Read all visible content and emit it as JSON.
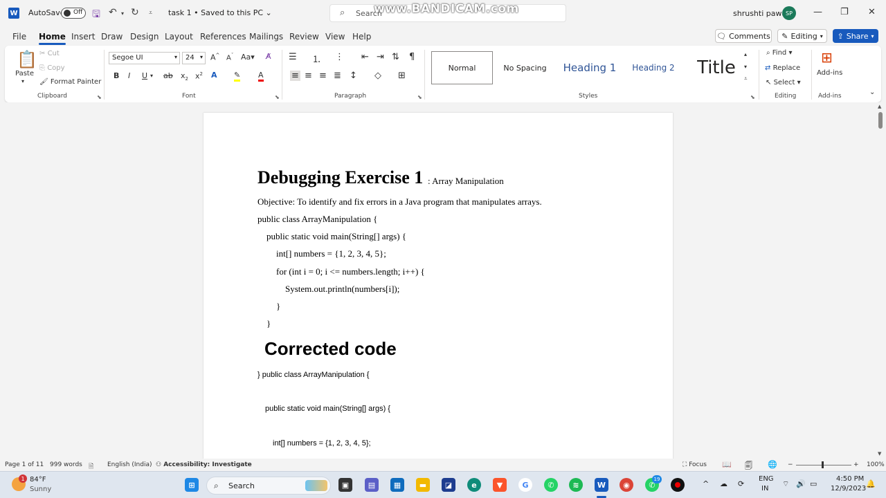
{
  "titlebar": {
    "autosave_label": "AutoSave",
    "autosave_state": "Off",
    "doc_title": "task 1 • Saved to this PC",
    "search_placeholder": "Search",
    "watermark": "www.BANDICAM.com",
    "user_name": "shrushti pawar",
    "user_initials": "SP"
  },
  "menu": {
    "tabs": [
      "File",
      "Home",
      "Insert",
      "Draw",
      "Design",
      "Layout",
      "References",
      "Mailings",
      "Review",
      "View",
      "Help"
    ],
    "comments": "Comments",
    "editing": "Editing",
    "share": "Share"
  },
  "ribbon": {
    "clipboard": {
      "paste": "Paste",
      "cut": "Cut",
      "copy": "Copy",
      "format_painter": "Format Painter",
      "label": "Clipboard"
    },
    "font": {
      "name": "Segoe UI",
      "size": "24",
      "label": "Font"
    },
    "paragraph": {
      "label": "Paragraph"
    },
    "styles": {
      "items": [
        "Normal",
        "No Spacing",
        "Heading 1",
        "Heading 2",
        "Title"
      ],
      "label": "Styles"
    },
    "editing": {
      "find": "Find",
      "replace": "Replace",
      "select": "Select",
      "label": "Editing"
    },
    "addins": {
      "button": "Add-ins",
      "label": "Add-ins"
    }
  },
  "document": {
    "heading": "Debugging Exercise 1",
    "heading_suffix": ": Array Manipulation",
    "objective": "Objective: To identify and fix errors in a Java program that manipulates arrays.",
    "code_lines": [
      "public class ArrayManipulation {",
      "public static void main(String[] args) {",
      "int[] numbers = {1, 2, 3, 4, 5};",
      "for (int i = 0; i <= numbers.length; i++) {",
      "System.out.println(numbers[i]);",
      "}",
      "}"
    ],
    "corrected_heading": "Corrected code",
    "corrected_lines": [
      "} public class ArrayManipulation {",
      "public static void main(String[] args) {",
      "int[] numbers = {1, 2, 3, 4, 5};"
    ]
  },
  "status": {
    "page": "Page 1 of 11",
    "words": "999 words",
    "language": "English (India)",
    "accessibility": "Accessibility: Investigate",
    "focus": "Focus",
    "zoom": "100%"
  },
  "taskbar": {
    "temp": "84°F",
    "weather": "Sunny",
    "weather_badge": "1",
    "search": "Search",
    "lang_top": "ENG",
    "lang_bottom": "IN",
    "time": "4:50 PM",
    "date": "12/9/2023",
    "whatsapp_badge": "19"
  }
}
